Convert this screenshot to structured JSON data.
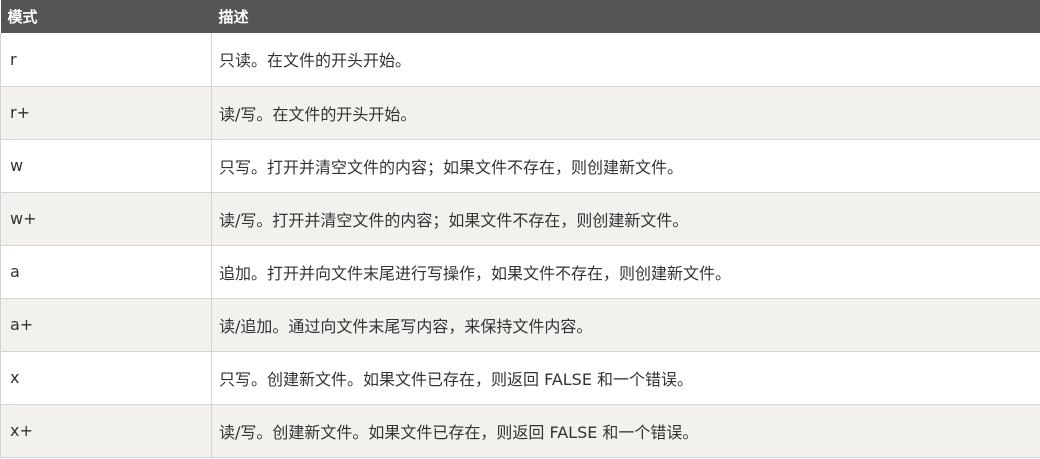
{
  "table": {
    "headers": {
      "mode": "模式",
      "description": "描述"
    },
    "rows": [
      {
        "mode": "r",
        "description": "只读。在文件的开头开始。"
      },
      {
        "mode": "r+",
        "description": "读/写。在文件的开头开始。"
      },
      {
        "mode": "w",
        "description": "只写。打开并清空文件的内容；如果文件不存在，则创建新文件。"
      },
      {
        "mode": "w+",
        "description": "读/写。打开并清空文件的内容；如果文件不存在，则创建新文件。"
      },
      {
        "mode": "a",
        "description": "追加。打开并向文件末尾进行写操作，如果文件不存在，则创建新文件。"
      },
      {
        "mode": "a+",
        "description": "读/追加。通过向文件末尾写内容，来保持文件内容。"
      },
      {
        "mode": "x",
        "description": "只写。创建新文件。如果文件已存在，则返回 FALSE 和一个错误。"
      },
      {
        "mode": "x+",
        "description": "读/写。创建新文件。如果文件已存在，则返回 FALSE 和一个错误。"
      }
    ]
  },
  "colors": {
    "header_background": "#555555",
    "header_text": "#ffffff",
    "row_alt_background": "#f2f1ed",
    "body_text": "#333333"
  }
}
